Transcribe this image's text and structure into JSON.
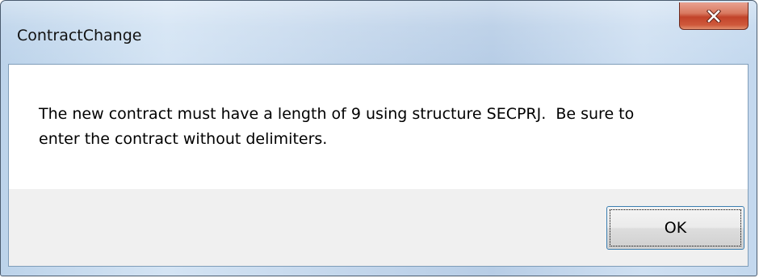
{
  "window": {
    "title": "ContractChange",
    "close_icon": "close-x-icon"
  },
  "message": {
    "line1": "The new contract must have a length of 9 using structure SECPRJ.  Be sure to",
    "line2": "enter the contract without delimiters."
  },
  "buttons": {
    "ok_label": "OK"
  },
  "colors": {
    "close_button": "#c2432a",
    "frame": "#c4d7ec",
    "button_panel": "#f0f0f0"
  }
}
